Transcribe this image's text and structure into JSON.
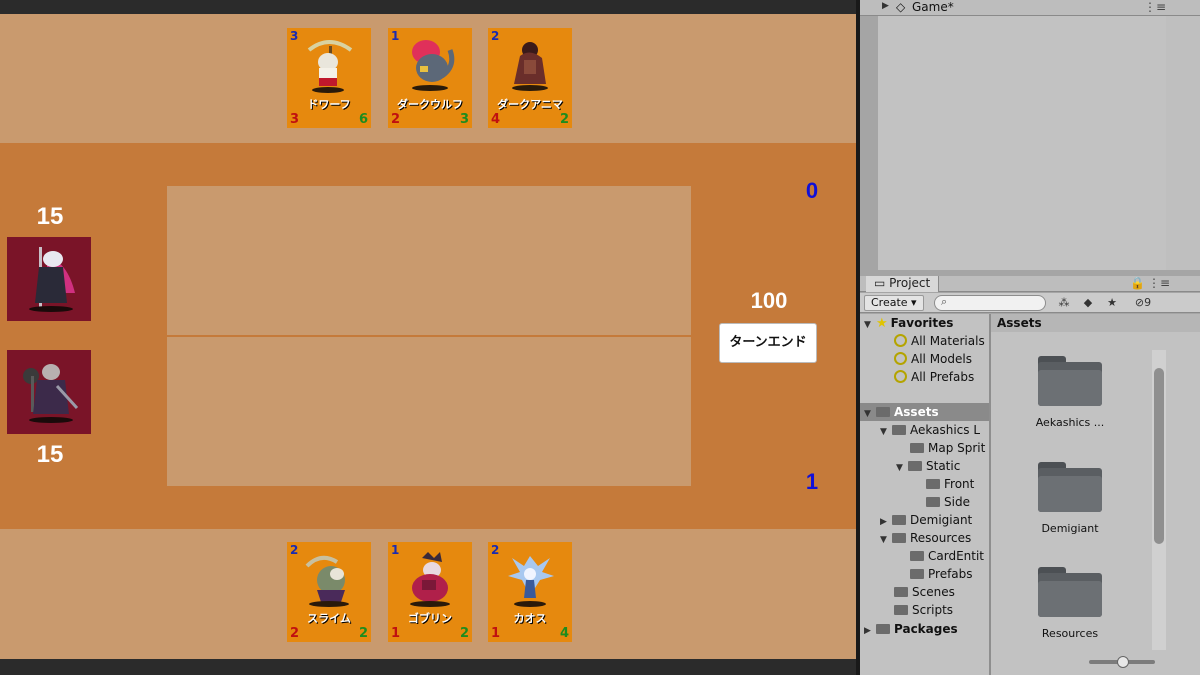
{
  "colors": {
    "hand_zone": "#c99a6e",
    "field_zone": "#c57a3a",
    "card_bg": "#e6890e",
    "hero_bg": "#7a1428",
    "cost": "#1b2bb0",
    "attack": "#c01010",
    "health": "#1e8c1e",
    "mana": "#1010d8"
  },
  "game": {
    "enemy_hand": [
      {
        "cost": "3",
        "name": "ドワーフ",
        "attack": "3",
        "health": "6",
        "icon": "dwarf-icon"
      },
      {
        "cost": "1",
        "name": "ダークウルフ",
        "attack": "2",
        "health": "3",
        "icon": "dark-wolf-icon"
      },
      {
        "cost": "2",
        "name": "ダークアニマ",
        "attack": "4",
        "health": "2",
        "icon": "dark-anima-icon"
      }
    ],
    "player_hand": [
      {
        "cost": "2",
        "name": "スライム",
        "attack": "2",
        "health": "2",
        "icon": "slime-icon"
      },
      {
        "cost": "1",
        "name": "ゴブリン",
        "attack": "1",
        "health": "2",
        "icon": "goblin-icon"
      },
      {
        "cost": "2",
        "name": "カオス",
        "attack": "1",
        "health": "4",
        "icon": "chaos-icon"
      }
    ],
    "enemy_hero_hp": "15",
    "player_hero_hp": "15",
    "enemy_mana": "0",
    "player_mana": "1",
    "timer": "100",
    "turn_end_label": "ターンエンド"
  },
  "editor": {
    "hierarchy_tab": "Game*",
    "project_tab": "Project",
    "create_label": "Create",
    "hidden_count": "9",
    "tree": {
      "favorites": "Favorites",
      "fav_items": [
        "All Materials",
        "All Models",
        "All Prefabs"
      ],
      "assets": "Assets",
      "aekashics": "Aekashics L",
      "map_sprit": "Map Sprit",
      "static": "Static",
      "front": "Front",
      "side": "Side",
      "demigiant": "Demigiant",
      "resources": "Resources",
      "card_entit": "CardEntit",
      "prefabs": "Prefabs",
      "scenes": "Scenes",
      "scripts": "Scripts",
      "packages": "Packages"
    },
    "assets_header": "Assets",
    "asset_folders": [
      "Aekashics ...",
      "Demigiant",
      "Resources"
    ]
  }
}
